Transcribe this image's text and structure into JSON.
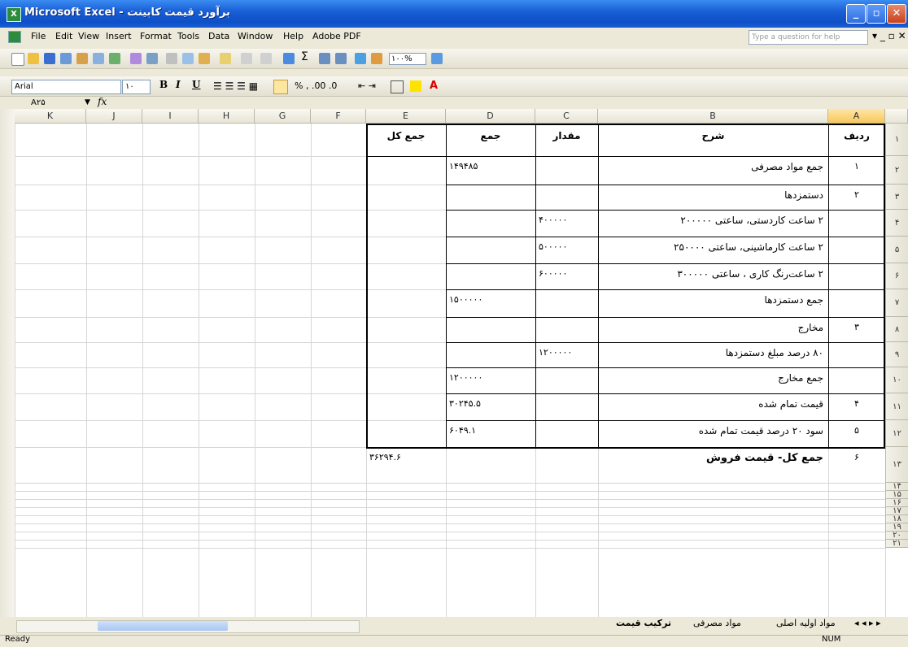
{
  "window": {
    "title": "Microsoft Excel - برآورد قیمت کابینت",
    "app_icon": "excel-icon",
    "controls": [
      "minimize",
      "maximize",
      "close"
    ]
  },
  "menu": {
    "items": [
      "File",
      "Edit",
      "View",
      "Insert",
      "Format",
      "Tools",
      "Data",
      "Window",
      "Help",
      "Adobe PDF"
    ],
    "ask_placeholder": "Type a question for help"
  },
  "standard_toolbar": {
    "zoom": "۱۰۰%"
  },
  "formatting_toolbar": {
    "font": "Arial",
    "size": "۱۰"
  },
  "formula_bar": {
    "name_box": "A۲۵",
    "fx_label": "fx"
  },
  "columns": [
    "K",
    "J",
    "I",
    "H",
    "G",
    "F",
    "E",
    "D",
    "C",
    "B",
    "A"
  ],
  "selected_column": "A",
  "row_numbers": [
    "۱",
    "۲",
    "۳",
    "۴",
    "۵",
    "۶",
    "۷",
    "۸",
    "۹",
    "۱۰",
    "۱۱",
    "۱۲",
    "۱۳",
    "۱۴",
    "۱۵",
    "۱۶",
    "۱۷",
    "۱۸",
    "۱۹",
    "۲۰",
    "۲۱"
  ],
  "table": {
    "headers": {
      "radif": "ردیف",
      "sharh": "شرح",
      "meqdar": "مقدار",
      "jam": "جمع",
      "jam_kol": "جمع کل"
    },
    "rows": [
      {
        "radif": "۱",
        "sharh": "جمع مواد مصرفی",
        "meqdar": "",
        "jam": "۱۴۹۴۸۵",
        "jam_kol": ""
      },
      {
        "radif": "۲",
        "sharh": "دستمزدها",
        "meqdar": "",
        "jam": "",
        "jam_kol": ""
      },
      {
        "radif": "",
        "sharh": "۲ ساعت کاردستی، ساعتی ۲۰۰۰۰۰",
        "meqdar": "۴۰۰۰۰۰",
        "jam": "",
        "jam_kol": ""
      },
      {
        "radif": "",
        "sharh": "۲ ساعت کارماشینی، ساعتی ۲۵۰۰۰۰",
        "meqdar": "۵۰۰۰۰۰",
        "jam": "",
        "jam_kol": ""
      },
      {
        "radif": "",
        "sharh": "۲ ساعت‌رنگ کاری ، ساعتی ۳۰۰۰۰۰",
        "meqdar": "۶۰۰۰۰۰",
        "jam": "",
        "jam_kol": ""
      },
      {
        "radif": "",
        "sharh": "جمع دستمزدها",
        "meqdar": "",
        "jam": "۱۵۰۰۰۰۰",
        "jam_kol": ""
      },
      {
        "radif": "۳",
        "sharh": "مخارج",
        "meqdar": "",
        "jam": "",
        "jam_kol": ""
      },
      {
        "radif": "",
        "sharh": "۸۰ درصد مبلغ دستمزدها",
        "meqdar": "۱۲۰۰۰۰۰",
        "jam": "",
        "jam_kol": ""
      },
      {
        "radif": "",
        "sharh": "جمع مخارج",
        "meqdar": "",
        "jam": "۱۲۰۰۰۰۰",
        "jam_kol": ""
      },
      {
        "radif": "۴",
        "sharh": "قیمت تمام شده",
        "meqdar": "",
        "jam": "۳۰۲۴۵.۵",
        "jam_kol": ""
      },
      {
        "radif": "۵",
        "sharh": "سود ۲۰ درصد قیمت تمام شده",
        "meqdar": "",
        "jam": "۶۰۴۹.۱",
        "jam_kol": ""
      },
      {
        "radif": "۶",
        "sharh": "جمع کل- قیمت فروش",
        "meqdar": "",
        "jam": "",
        "jam_kol": "۳۶۲۹۴.۶"
      }
    ]
  },
  "sheet_tabs": {
    "active": "ترکیب قیمت",
    "others": [
      "مواد مصرفی",
      "مواد اولیه اصلی"
    ]
  },
  "status": {
    "left": "Ready",
    "right": "NUM"
  }
}
